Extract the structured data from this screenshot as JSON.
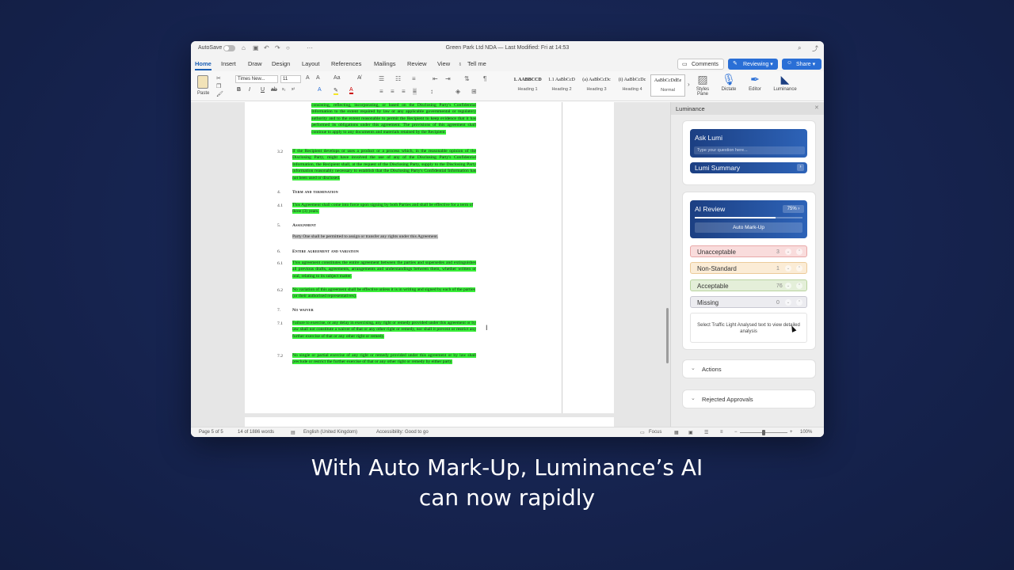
{
  "titlebar": {
    "autosave_label": "AutoSave",
    "document_title": "Green Park Ltd NDA — Last Modified: Fri at 14:53"
  },
  "tabs": [
    "Home",
    "Insert",
    "Draw",
    "Design",
    "Layout",
    "References",
    "Mailings",
    "Review",
    "View",
    "Tell me"
  ],
  "buttons": {
    "comments": "Comments",
    "reviewing": "Reviewing",
    "share": "Share"
  },
  "ribbon": {
    "paste": "Paste",
    "font_name": "Times New...",
    "font_size": "11",
    "styles": [
      {
        "sample": "1. AABBCCD",
        "name": "Heading 1"
      },
      {
        "sample": "1.1 AaBbCcD",
        "name": "Heading 2"
      },
      {
        "sample": "(a) AaBbCcDc",
        "name": "Heading 3"
      },
      {
        "sample": "(i) AaBbCcDc",
        "name": "Heading 4"
      },
      {
        "sample": "AaBbCcDdEe",
        "name": "Normal"
      }
    ],
    "tools": [
      "Styles Pane",
      "Dictate",
      "Editor",
      "Luminance"
    ]
  },
  "document": {
    "clause_3_1_tail": "consisting, reflecting, incorporating, or based on the Disclosing Party's Confidential Information to the extent required by law or any applicable governmental or regulatory authority and to the extent reasonable to permit the Recipient to keep evidence that it has performed its obligations under this agreement. The provisions of this agreement shall continue to apply to any documents and materials retained by the Recipient.",
    "clause_3_2_num": "3.2",
    "clause_3_2": "If the Recipient develops or uses a product or a process which, in the reasonable opinion of the Disclosing Party, might have involved the use of any of the Disclosing Party's Confidential Information, the Recipient shall, at the request of the Disclosing Party, supply to the Disclosing Party information reasonably necessary to establish that the Disclosing Party's Confidential Information has not been used or disclosed.",
    "h4_num": "4.",
    "h4": "Term and termination",
    "clause_4_1_num": "4.1",
    "clause_4_1": "This Agreement shall come into force upon signing by both Parties and shall be effective for a term of three (3) years.",
    "h5_num": "5.",
    "h5": "Assignment",
    "clause_5": "Party One shall be permitted to assign or transfer any rights under this Agreement.",
    "h6_num": "6.",
    "h6": "Entire agreement and variation",
    "clause_6_1_num": "6.1",
    "clause_6_1": "This agreement constitutes the entire agreement between the parties and supersedes and extinguishes all previous drafts, agreements, arrangements and understandings between them, whether written or oral, relating to its subject matter.",
    "clause_6_2_num": "6.2",
    "clause_6_2": "No variation of this agreement shall be effective unless it is in writing and signed by each of the parties (or their authorised representatives).",
    "h7_num": "7.",
    "h7": "No waiver",
    "clause_7_1_num": "7.1",
    "clause_7_1": "Failure to exercise, or any delay in exercising, any right or remedy provided under this agreement or by law shall not constitute a waiver of that or any other right or remedy, nor shall it prevent or restrict any further exercise of that or any other right or remedy.",
    "clause_7_2_num": "7.2",
    "clause_7_2": "No single or partial exercise of any right or remedy provided under this agreement or by law shall preclude or restrict the further exercise of that or any other right or remedy by either party."
  },
  "panel": {
    "title": "Luminance",
    "ask_lumi": "Ask Lumi",
    "ask_placeholder": "Type your question here...",
    "lumi_summary": "Lumi Summary",
    "ai_review": "AI Review",
    "review_progress_label": "75%",
    "review_progress": 0.75,
    "auto_markup": "Auto Mark-Up",
    "traffic_lights": [
      {
        "label": "Unacceptable",
        "count": "3",
        "bg": "#f9dcdc",
        "border": "#e8a8a8"
      },
      {
        "label": "Non-Standard",
        "count": "1",
        "bg": "#fbecd6",
        "border": "#eccb9a"
      },
      {
        "label": "Acceptable",
        "count": "76",
        "bg": "#e4efd9",
        "border": "#b9d4a0"
      },
      {
        "label": "Missing",
        "count": "0",
        "bg": "#ececf0",
        "border": "#c8c8d2"
      }
    ],
    "hint": "Select Traffic Light Analysed text to view detailed analysis",
    "actions": "Actions",
    "rejected": "Rejected Approvals"
  },
  "statusbar": {
    "page": "Page 5 of 5",
    "words": "14 of 1886 words",
    "language": "English (United Kingdom)",
    "accessibility": "Accessibility: Good to go",
    "focus": "Focus",
    "zoom": "100%"
  },
  "subtitle": {
    "line1": "With Auto Mark-Up, Luminance’s AI",
    "line2": "can now rapidly"
  },
  "colors": {
    "accent": "#2a6fd6",
    "highlight": "#38ef38",
    "panel_navy": "#1c3f82"
  }
}
